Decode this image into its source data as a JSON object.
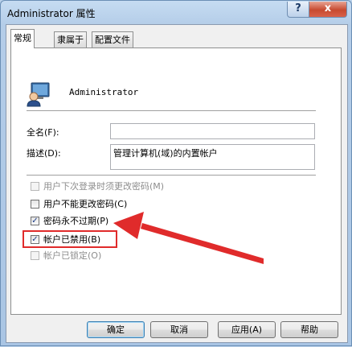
{
  "window": {
    "title": "Administrator 属性",
    "help_glyph": "?",
    "close_glyph": "x"
  },
  "tabs": [
    {
      "label": "常规",
      "active": true
    },
    {
      "label": "隶属于",
      "active": false
    },
    {
      "label": "配置文件",
      "active": false
    }
  ],
  "user": {
    "name": "Administrator"
  },
  "fields": {
    "fullname_label": "全名(F):",
    "fullname_value": "",
    "description_label": "描述(D):",
    "description_value": "管理计算机(域)的内置帐户"
  },
  "checkboxes": [
    {
      "label": "用户下次登录时须更改密码(M)",
      "checked": false,
      "enabled": false
    },
    {
      "label": "用户不能更改密码(C)",
      "checked": false,
      "enabled": true
    },
    {
      "label": "密码永不过期(P)",
      "checked": true,
      "enabled": true
    },
    {
      "label": "帐户已禁用(B)",
      "checked": true,
      "enabled": true
    },
    {
      "label": "帐户已锁定(O)",
      "checked": false,
      "enabled": false
    }
  ],
  "buttons": {
    "ok": "确定",
    "cancel": "取消",
    "apply": "应用(A)",
    "help": "帮助"
  },
  "colors": {
    "highlight": "#e02b2b",
    "arrow": "#e02b2b"
  },
  "icons": {
    "user": "user-computer-icon"
  }
}
